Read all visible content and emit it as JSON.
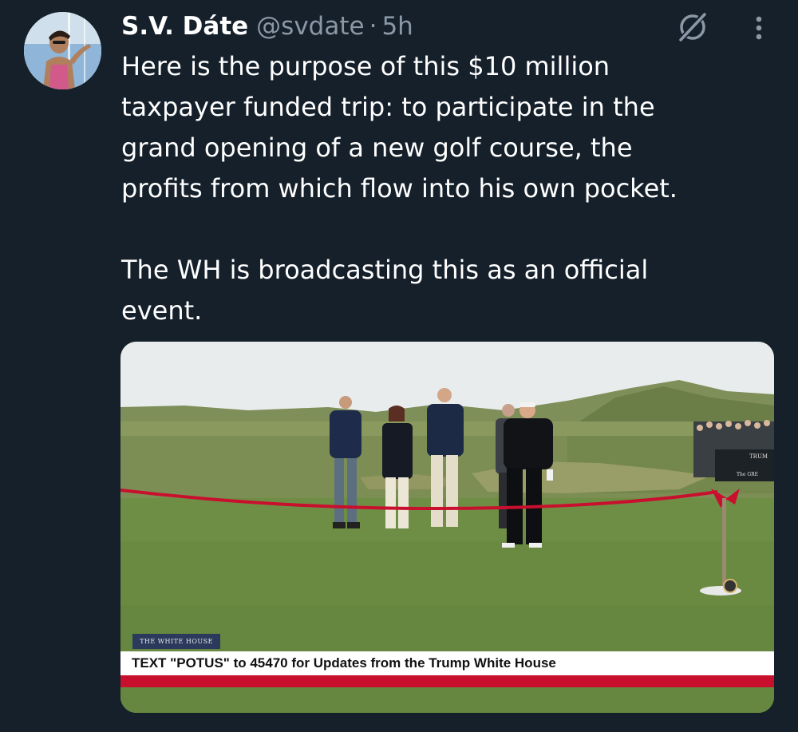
{
  "author": {
    "name": "S.V. Dáte",
    "handle": "@svdate",
    "separator": "·",
    "time": "5h"
  },
  "tweet": {
    "paragraph1": "Here is the purpose of this $10 million\ntaxpayer funded trip: to participate in the\ngrand opening of a new golf course, the\nprofits from which flow into his own pocket.",
    "paragraph2": "The WH is broadcasting this as an official\nevent."
  },
  "media": {
    "source_tag": "THE WHITE HOUSE",
    "banner_text": "TEXT \"POTUS\" to 45470 for Updates from the Trump White House",
    "sign_text": [
      "TRUM",
      "The GRE"
    ]
  },
  "icons": {
    "grok": "grok-icon",
    "more": "more-options-icon"
  },
  "colors": {
    "background": "#15202b",
    "secondary_text": "#8b98a5",
    "banner_red": "#c8102e"
  }
}
